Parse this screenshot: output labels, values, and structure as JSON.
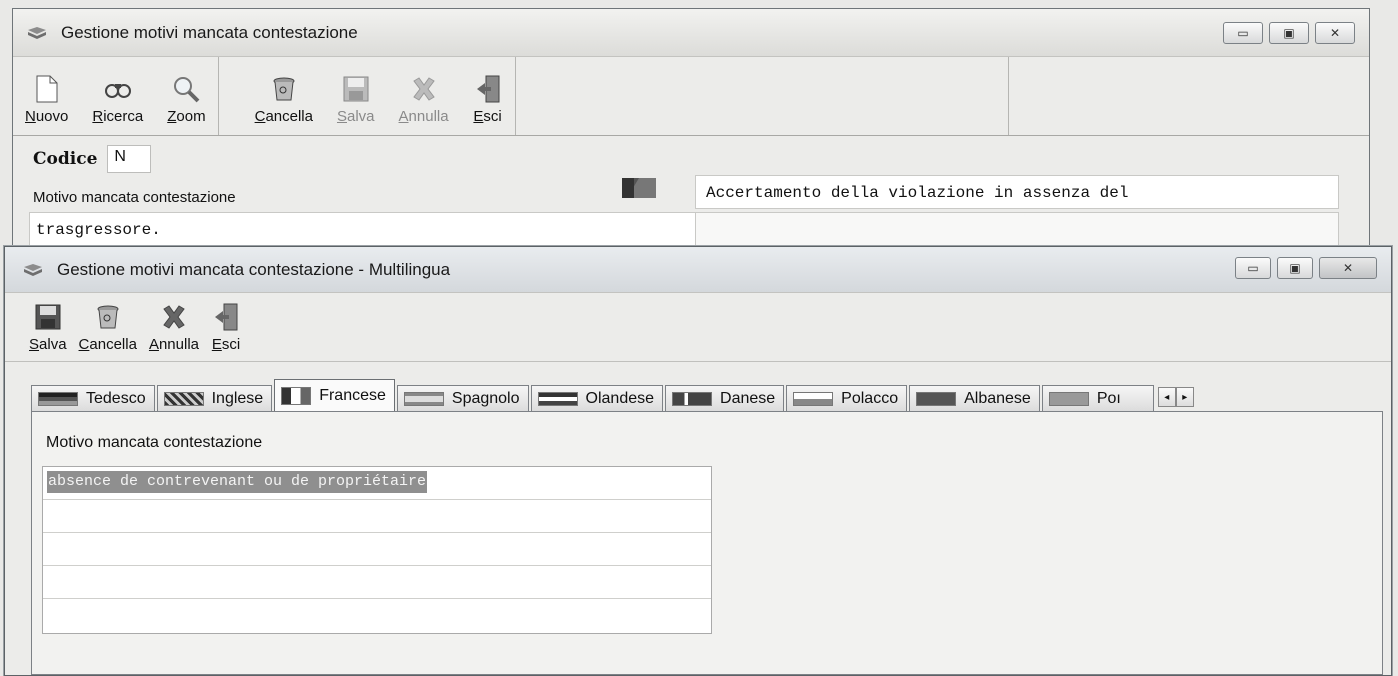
{
  "main_window": {
    "title": "Gestione motivi mancata contestazione",
    "toolbar": {
      "nuovo": {
        "label": "Nuovo",
        "mnemonic": "N",
        "rest": "uovo"
      },
      "ricerca": {
        "label": "Ricerca",
        "mnemonic": "R",
        "rest": "icerca"
      },
      "zoom": {
        "label": "Zoom",
        "mnemonic": "Z",
        "rest": "oom"
      },
      "cancella": {
        "label": "Cancella",
        "mnemonic": "C",
        "rest": "ancella"
      },
      "salva": {
        "label": "Salva",
        "mnemonic": "S",
        "rest": "alva"
      },
      "annulla": {
        "label": "Annulla",
        "mnemonic": "A",
        "rest": "nnulla"
      },
      "esci": {
        "label": "Esci",
        "mnemonic": "E",
        "rest": "sci"
      }
    },
    "codice_label": "Codice",
    "codice_value": "N",
    "motivo_label": "Motivo mancata contestazione",
    "descrizione_line1": "Accertamento della violazione in assenza del",
    "descrizione_line2": "trasgressore."
  },
  "multilingua_window": {
    "title": "Gestione motivi mancata contestazione - Multilingua",
    "toolbar": {
      "salva": {
        "label": "Salva",
        "mnemonic": "S",
        "rest": "alva"
      },
      "cancella": {
        "label": "Cancella",
        "mnemonic": "C",
        "rest": "ancella"
      },
      "annulla": {
        "label": "Annulla",
        "mnemonic": "A",
        "rest": "nnulla"
      },
      "esci": {
        "label": "Esci",
        "mnemonic": "E",
        "rest": "sci"
      }
    },
    "tabs": [
      {
        "label": "Tedesco"
      },
      {
        "label": "Inglese"
      },
      {
        "label": "Francese",
        "active": true
      },
      {
        "label": "Spagnolo"
      },
      {
        "label": "Olandese"
      },
      {
        "label": "Danese"
      },
      {
        "label": "Polacco"
      },
      {
        "label": "Albanese"
      },
      {
        "label": "Poı"
      }
    ],
    "field_label": "Motivo mancata contestazione",
    "field_value": "absence de contrevenant ou de propriétaire"
  },
  "colors": {
    "selection": "#8f8f8f",
    "window_bg": "#ececea"
  }
}
